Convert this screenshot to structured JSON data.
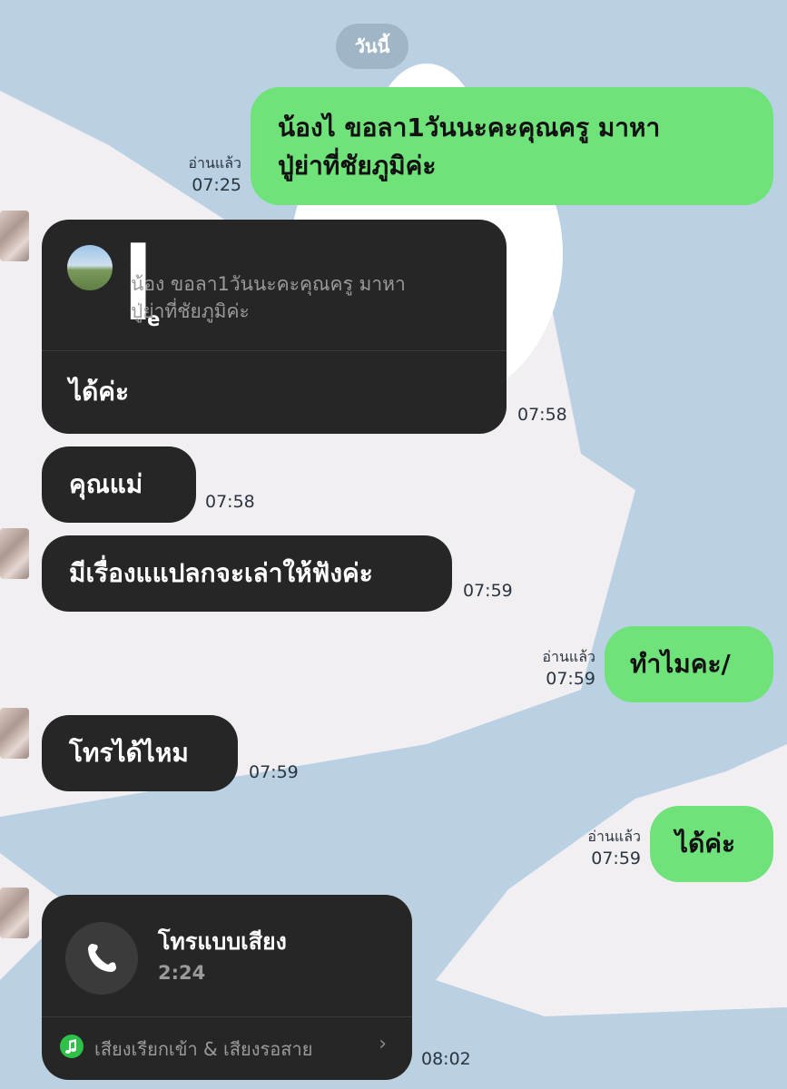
{
  "date_separator": "วันนี้",
  "messages": [
    {
      "side": "out",
      "text_line1": "น้องไ      ขอลา1วันนะคะคุณครู มาหา",
      "text_line2": "ปู่ย่าที่ชัยภูมิค่ะ",
      "read": "อ่านแล้ว",
      "time": "07:25"
    },
    {
      "side": "in",
      "reply_name": "█ █ █ ▀e",
      "reply_quote_line1": "น้อง       ขอลา1วันนะคะคุณครู มาหา",
      "reply_quote_line2": "ปู่ย่าที่ชัยภูมิค่ะ",
      "text": "ได้ค่ะ",
      "time": "07:58"
    },
    {
      "side": "in",
      "text": "คุณแม่",
      "time": "07:58"
    },
    {
      "side": "in",
      "text": "มีเรื่องแแปลกจะเล่าให้ฟังค่ะ",
      "time": "07:59"
    },
    {
      "side": "out",
      "text": "ทำไมคะ/",
      "read": "อ่านแล้ว",
      "time": "07:59"
    },
    {
      "side": "in",
      "text": "โทรได้ไหม",
      "time": "07:59"
    },
    {
      "side": "out",
      "text": "ได้ค่ะ",
      "read": "อ่านแล้ว",
      "time": "07:59"
    },
    {
      "side": "in",
      "call_title": "โทรแบบเสียง",
      "call_duration": "2:24",
      "ringtone_label": "เสียงเรียกเข้า & เสียงรอสาย",
      "time": "08:02"
    }
  ],
  "icons": {
    "phone": "phone-icon",
    "music": "music-note-icon",
    "chevron": "chevron-right-icon"
  },
  "colors": {
    "outgoing_bubble": "#6fe27a",
    "incoming_bubble": "#262626",
    "background": "#b9d1e2"
  }
}
